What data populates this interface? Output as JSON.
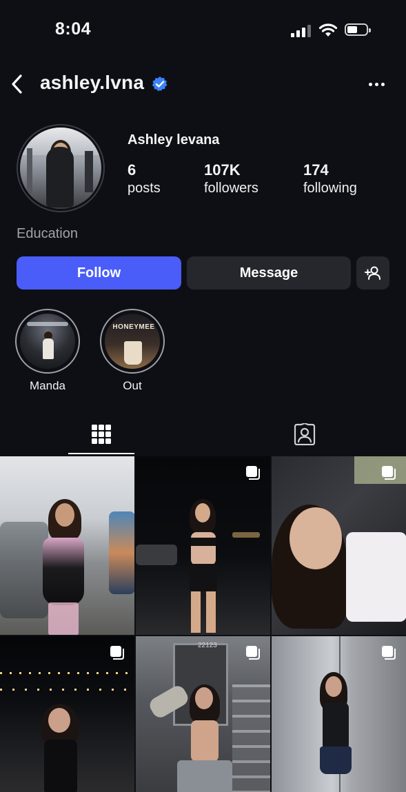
{
  "status_bar": {
    "time": "8:04",
    "signal_icon": "cellular-signal-icon",
    "wifi_icon": "wifi-icon",
    "battery_icon": "battery-icon"
  },
  "header": {
    "username": "ashley.lvna",
    "verified_icon": "verified-badge-icon",
    "back_icon": "chevron-left-icon",
    "more_icon": "more-horizontal-icon"
  },
  "profile": {
    "display_name": "Ashley levana",
    "stats": [
      {
        "value": "6",
        "label": "posts"
      },
      {
        "value": "107K",
        "label": "followers"
      },
      {
        "value": "174",
        "label": "following"
      }
    ],
    "category": "Education"
  },
  "actions": {
    "follow_label": "Follow",
    "message_label": "Message",
    "suggest_icon": "add-person-icon"
  },
  "colors": {
    "accent": "#4a5df9",
    "verified": "#3b82f6",
    "background": "#0d0f14",
    "button_secondary": "#25272d",
    "muted_text": "#a1a3aa"
  },
  "highlights": [
    {
      "label": "Manda"
    },
    {
      "label": "Out",
      "image_text": "HONEYMEE"
    }
  ],
  "tabs": [
    {
      "name": "posts-grid",
      "icon": "grid-icon",
      "active": true
    },
    {
      "name": "tagged",
      "icon": "tagged-person-icon",
      "active": false
    }
  ],
  "posts": [
    {
      "multi": false
    },
    {
      "multi": true,
      "multi_icon": "carousel-icon"
    },
    {
      "multi": true,
      "multi_icon": "carousel-icon"
    },
    {
      "multi": true,
      "multi_icon": "carousel-icon"
    },
    {
      "multi": true,
      "multi_icon": "carousel-icon",
      "image_text": "22123"
    },
    {
      "multi": true,
      "multi_icon": "carousel-icon"
    }
  ]
}
